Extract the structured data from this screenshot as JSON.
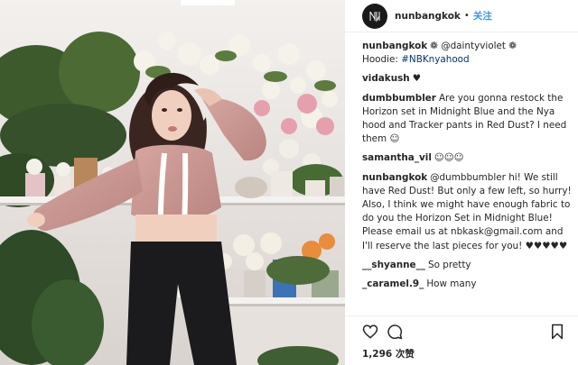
{
  "post": {
    "username": "nunbangkok",
    "dot": "•",
    "follow_label": "关注"
  },
  "comments": [
    {
      "user": "nunbangkok",
      "emoji": "❁",
      "mention": "@daintyviolet",
      "emoji2": "❁",
      "line2": "Hoodie: ",
      "hashtag": "#NBKnyahood"
    },
    {
      "user": "vidakush",
      "text": "♥"
    },
    {
      "user": "dumbbumbler",
      "text": "Are you gonna restock the Horizon set in Midnight Blue and the Nya hood and Tracker pants in Red Dust? I need them ☺"
    },
    {
      "user": "samantha_vil",
      "text": "☺☺☺"
    },
    {
      "user": "nunbangkok",
      "mention": "@dumbbumbler",
      "text": " hi! We still have Red Dust! But only a few left, so hurry! Also, I think we might have enough fabric to do you the Horizon Set in Midnight Blue! Please email us at nbkask@gmail.com and I'll reserve the last pieces for you! ♥♥♥♥♥"
    },
    {
      "user": "__shyanne__",
      "text": "So pretty"
    },
    {
      "user": "_caramel.9_",
      "text": "How many"
    }
  ],
  "likes": "1,296 次赞",
  "icons": {
    "like": "heart-icon",
    "comment": "comment-icon",
    "save": "bookmark-icon"
  },
  "colors": {
    "link": "#3897f0",
    "text": "#262626",
    "hashtag": "#003569"
  }
}
